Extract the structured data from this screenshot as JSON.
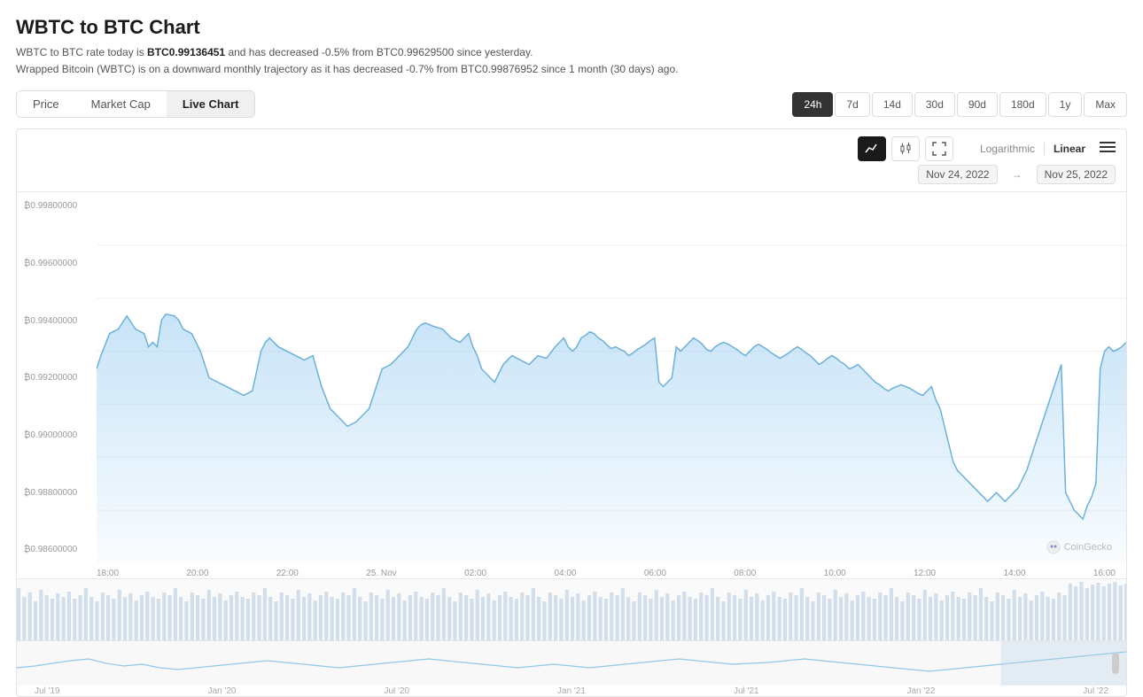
{
  "title": "WBTC to BTC Chart",
  "description": {
    "line1_prefix": "WBTC to BTC rate today is ",
    "rate": "BTC0.99136451",
    "line1_suffix": " and has decreased -0.5% from BTC0.99629500 since yesterday.",
    "line2": "Wrapped Bitcoin (WBTC) is on a downward monthly trajectory as it has decreased -0.7% from BTC0.99876952 since 1 month (30 days) ago."
  },
  "tabs": [
    {
      "label": "Price",
      "active": false
    },
    {
      "label": "Market Cap",
      "active": false
    },
    {
      "label": "Live Chart",
      "active": true
    }
  ],
  "time_buttons": [
    {
      "label": "24h",
      "active": true
    },
    {
      "label": "7d",
      "active": false
    },
    {
      "label": "14d",
      "active": false
    },
    {
      "label": "30d",
      "active": false
    },
    {
      "label": "90d",
      "active": false
    },
    {
      "label": "180d",
      "active": false
    },
    {
      "label": "1y",
      "active": false
    },
    {
      "label": "Max",
      "active": false
    }
  ],
  "chart_icons": [
    {
      "name": "line-chart-icon",
      "symbol": "📈",
      "active": true
    },
    {
      "name": "bar-chart-icon",
      "symbol": "📊",
      "active": false
    },
    {
      "name": "fullscreen-icon",
      "symbol": "⛶",
      "active": false
    }
  ],
  "scale": {
    "logarithmic": "Logarithmic",
    "linear": "Linear",
    "active": "linear"
  },
  "date_range": {
    "from": "Nov 24, 2022",
    "to": "Nov 25, 2022",
    "separator": "→"
  },
  "y_labels": [
    "₿0.99800000",
    "₿0.99600000",
    "₿0.99400000",
    "₿0.99200000",
    "₿0.99000000",
    "₿0.98800000",
    "₿0.98600000"
  ],
  "x_labels": [
    "18:00",
    "20:00",
    "22:00",
    "25. Nov",
    "02:00",
    "04:00",
    "06:00",
    "08:00",
    "10:00",
    "12:00",
    "14:00",
    "16:00"
  ],
  "mini_x_labels": [
    "Jul '19",
    "Jan '20",
    "Jul '20",
    "Jan '21",
    "Jul '21",
    "Jan '22",
    "Jul '22"
  ],
  "watermark": "CoinGecko"
}
